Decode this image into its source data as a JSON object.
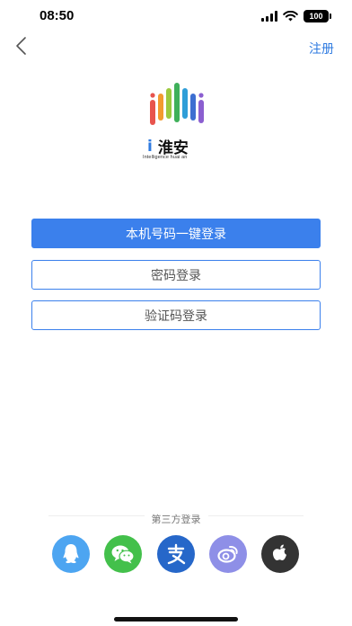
{
  "status_bar": {
    "time": "08:50",
    "battery": "100"
  },
  "nav": {
    "register_label": "注册"
  },
  "logo": {
    "title": "淮安",
    "i_mark": "i",
    "subtitle": "Intelligence huai an"
  },
  "buttons": {
    "one_click_login": "本机号码一键登录",
    "password_login": "密码登录",
    "code_login": "验证码登录"
  },
  "third_party": {
    "label": "第三方登录",
    "providers": [
      "qq-icon",
      "wechat-icon",
      "alipay-icon",
      "weibo-icon",
      "apple-icon"
    ]
  },
  "colors": {
    "accent": "#3b80ec",
    "link": "#2e7ae0",
    "qq": "#4da5f1",
    "wechat": "#43c04b",
    "alipay": "#2667c9",
    "weibo": "#8e8fe7",
    "apple": "#333333"
  }
}
